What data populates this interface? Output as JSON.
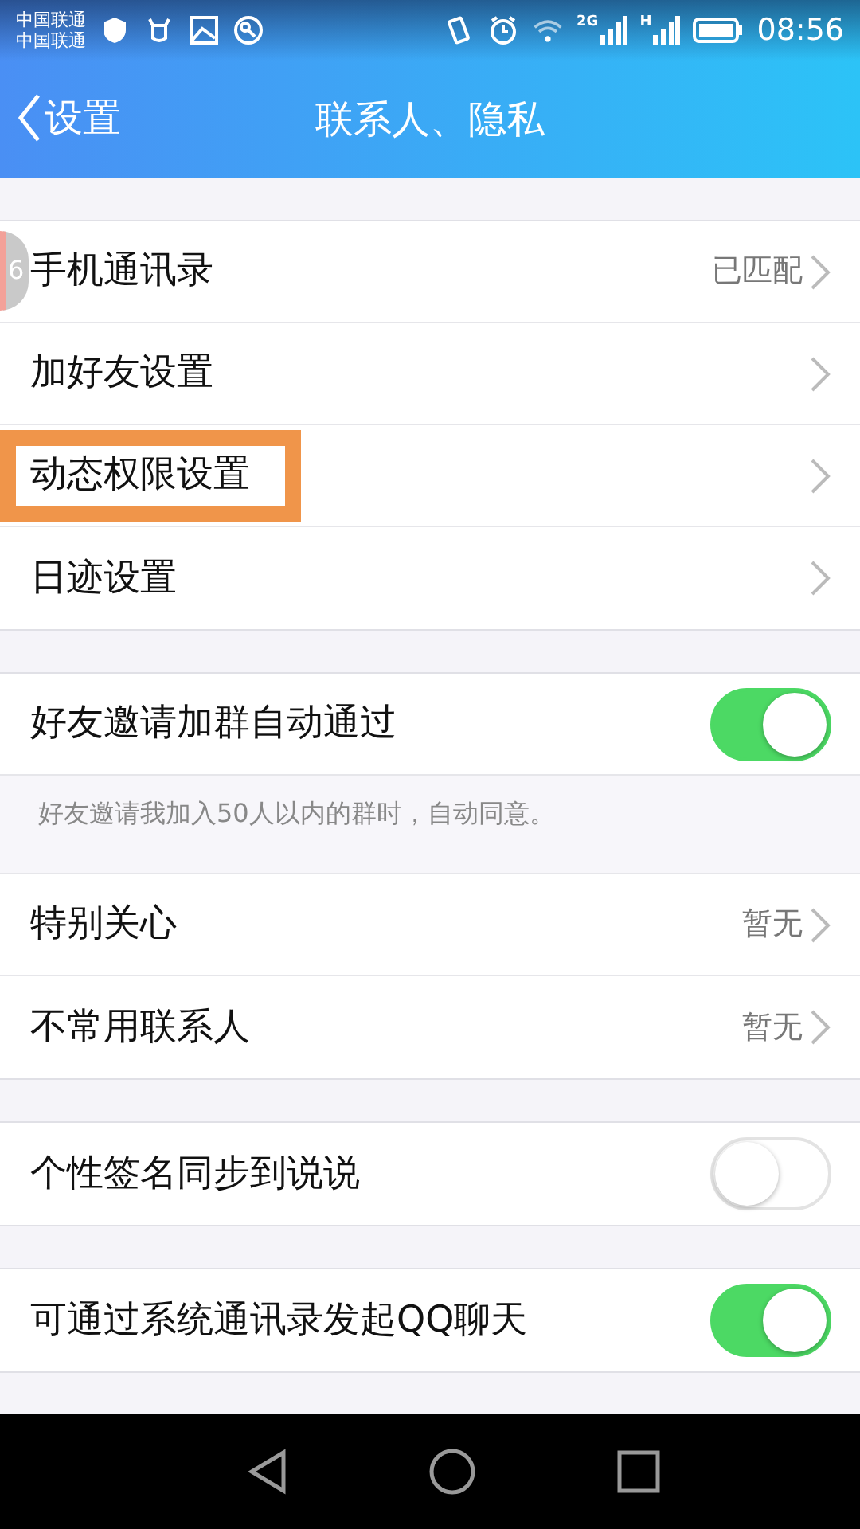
{
  "status_bar": {
    "carriers": [
      "中国联通",
      "中国联通"
    ],
    "network_labels": [
      "2G",
      "H"
    ],
    "time": "08:56"
  },
  "header": {
    "back_label": "设置",
    "title": "联系人、隐私"
  },
  "floating_ball": {
    "text": "6"
  },
  "groups": [
    {
      "items": [
        {
          "kind": "link",
          "label": "手机通讯录",
          "value": "已匹配",
          "highlighted": false
        },
        {
          "kind": "link",
          "label": "加好友设置",
          "highlighted": false
        },
        {
          "kind": "link",
          "label": "动态权限设置",
          "highlighted": true
        },
        {
          "kind": "link",
          "label": "日迹设置",
          "highlighted": false
        }
      ]
    },
    {
      "items": [
        {
          "kind": "toggle",
          "label": "好友邀请加群自动通过",
          "on": true
        },
        {
          "kind": "note",
          "label": "好友邀请我加入50人以内的群时，自动同意。"
        },
        {
          "kind": "link",
          "label": "特别关心",
          "value": "暂无",
          "highlighted": false
        },
        {
          "kind": "link",
          "label": "不常用联系人",
          "value": "暂无",
          "highlighted": false
        }
      ]
    },
    {
      "items": [
        {
          "kind": "toggle",
          "label": "个性签名同步到说说",
          "on": false
        }
      ]
    },
    {
      "items": [
        {
          "kind": "toggle",
          "label": "可通过系统通讯录发起QQ聊天",
          "on": true
        }
      ]
    }
  ]
}
